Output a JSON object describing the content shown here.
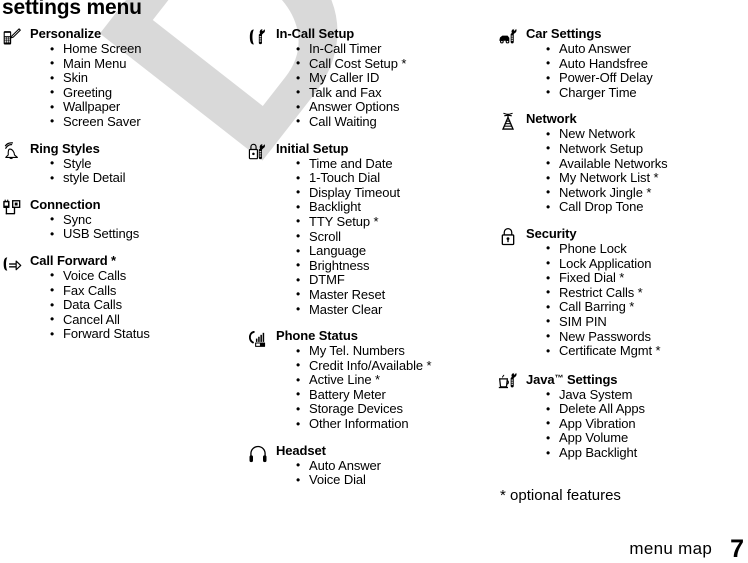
{
  "page": {
    "title": "settings menu",
    "footnote": "* optional features",
    "footer_label": "menu map",
    "footer_page": "7",
    "watermark": "DRAFT",
    "watermark_color": "#d9d9d9"
  },
  "columns": [
    {
      "groups": [
        {
          "icon": "phone-pen-icon",
          "title": "Personalize",
          "items": [
            "Home Screen",
            "Main Menu",
            "Skin",
            "Greeting",
            "Wallpaper",
            "Screen Saver"
          ]
        },
        {
          "icon": "ringing-bell-icon",
          "title": "Ring Styles",
          "items": [
            "Style",
            " style Detail"
          ]
        },
        {
          "icon": "plug-connector-icon",
          "title": "Connection",
          "items": [
            "Sync",
            "USB Settings"
          ]
        },
        {
          "icon": "handset-arrow-icon",
          "title": "Call Forward *",
          "items": [
            "Voice Calls",
            "Fax Calls",
            "Data Calls",
            "Cancel All",
            "Forward Status"
          ]
        }
      ]
    },
    {
      "groups": [
        {
          "icon": "handset-wrench-icon",
          "title": "In-Call Setup",
          "items": [
            "In-Call Timer",
            "Call Cost Setup *",
            "My Caller ID",
            "Talk and Fax",
            "Answer Options",
            "Call Waiting"
          ]
        },
        {
          "icon": "lock-wrench-icon",
          "title": "Initial Setup",
          "items": [
            "Time and Date",
            "1-Touch Dial",
            "Display Timeout",
            "Backlight",
            "TTY Setup *",
            "Scroll",
            "Language",
            "Brightness",
            "DTMF",
            "Master Reset",
            "Master Clear"
          ]
        },
        {
          "icon": "signal-battery-icon",
          "title": "Phone Status",
          "items": [
            "My Tel. Numbers",
            "Credit Info/Available *",
            "Active Line *",
            "Battery Meter",
            "Storage Devices",
            "Other Information"
          ]
        },
        {
          "icon": "headset-icon",
          "title": "Headset",
          "items": [
            "Auto Answer",
            "Voice Dial"
          ]
        }
      ]
    },
    {
      "groups": [
        {
          "icon": "car-wrench-icon",
          "title": "Car Settings",
          "items": [
            "Auto Answer",
            "Auto Handsfree",
            "Power-Off Delay",
            "Charger Time"
          ]
        },
        {
          "icon": "radio-tower-icon",
          "title": "Network",
          "items": [
            "New Network",
            "Network Setup",
            "Available Networks",
            "My Network List *",
            "Network Jingle *",
            "Call Drop Tone"
          ]
        },
        {
          "icon": "padlock-icon",
          "title": "Security",
          "items": [
            "Phone Lock",
            "Lock Application",
            "Fixed Dial *",
            "Restrict Calls *",
            "Call Barring *",
            "SIM PIN",
            "New Passwords",
            "Certificate Mgmt *"
          ]
        },
        {
          "icon": "coffee-cup-wrench-icon",
          "title": "Java™ Settings",
          "items": [
            "Java System",
            "Delete All Apps",
            "App Vibration",
            "App Volume",
            "App Backlight"
          ]
        }
      ]
    }
  ]
}
